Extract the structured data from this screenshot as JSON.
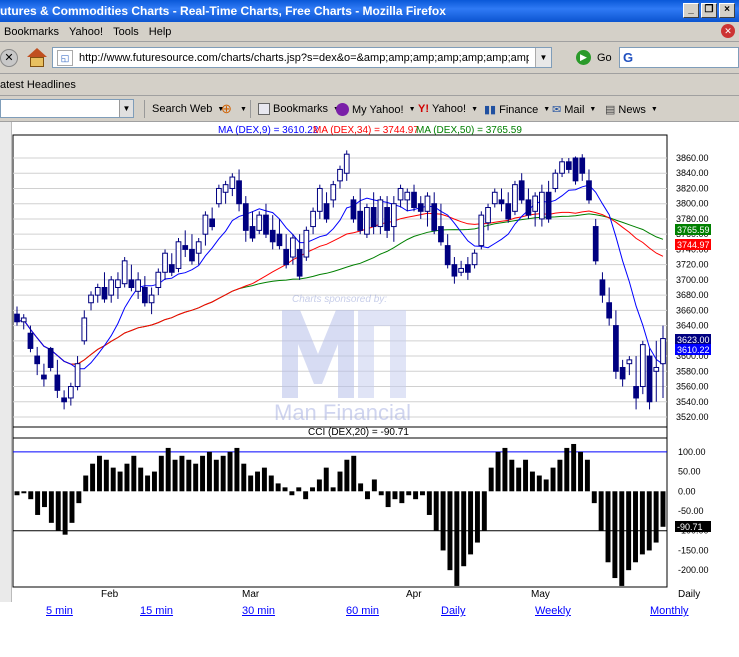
{
  "window": {
    "title": "utures & Commodities Charts - Real-Time Charts, Free Charts - Mozilla Firefox"
  },
  "menu": [
    "Bookmarks",
    "Yahoo!",
    "Tools",
    "Help"
  ],
  "nav": {
    "url": "http://www.futuresource.com/charts/charts.jsp?s=dex&o=&amp;amp;amp;amp;amp;amp;amp;amp;amp;a=",
    "go_label": "Go"
  },
  "bookmarks_bar": {
    "item": "atest Headlines"
  },
  "yahoo_toolbar": {
    "search_web": "Search Web",
    "bookmarks": "Bookmarks",
    "my_yahoo": "My Yahoo!",
    "yahoo": "Yahoo!",
    "finance": "Finance",
    "mail": "Mail",
    "news": "News"
  },
  "chart_data": {
    "type": "candlestick",
    "symbol": "DEX",
    "indicator_header": {
      "ma9": "MA (DEX,9) = 3610.22",
      "ma34": "MA (DEX,34) = 3744.97",
      "ma50": "MA (DEX,50) = 3765.59"
    },
    "y_ticks": [
      "3860.00",
      "3840.00",
      "3820.00",
      "3800.00",
      "3780.00",
      "3760.00",
      "3740.00",
      "3720.00",
      "3700.00",
      "3680.00",
      "3660.00",
      "3640.00",
      "3620.00",
      "3600.00",
      "3580.00",
      "3560.00",
      "3540.00",
      "3520.00"
    ],
    "ylim": [
      3520,
      3860
    ],
    "x_labels": [
      "Feb",
      "Mar",
      "Apr",
      "May",
      "Daily"
    ],
    "value_badges": {
      "ma50": "3765.59",
      "ma34": "3744.97",
      "last": "3623.00",
      "ma9": "3610.22"
    },
    "colors": {
      "ma9": "#0000ff",
      "ma34": "#ff0000",
      "ma50": "#008000",
      "candle": "#000080",
      "cci": "#000000"
    },
    "candles": [
      [
        3655,
        3665,
        3640,
        3645
      ],
      [
        3645,
        3655,
        3635,
        3650
      ],
      [
        3630,
        3640,
        3605,
        3610
      ],
      [
        3600,
        3612,
        3575,
        3590
      ],
      [
        3575,
        3590,
        3560,
        3570
      ],
      [
        3610,
        3612,
        3580,
        3585
      ],
      [
        3575,
        3595,
        3545,
        3555
      ],
      [
        3545,
        3555,
        3530,
        3540
      ],
      [
        3545,
        3565,
        3535,
        3560
      ],
      [
        3560,
        3600,
        3555,
        3590
      ],
      [
        3620,
        3660,
        3615,
        3650
      ],
      [
        3670,
        3685,
        3660,
        3680
      ],
      [
        3680,
        3695,
        3670,
        3690
      ],
      [
        3690,
        3710,
        3670,
        3675
      ],
      [
        3680,
        3705,
        3670,
        3700
      ],
      [
        3690,
        3710,
        3675,
        3700
      ],
      [
        3695,
        3730,
        3690,
        3725
      ],
      [
        3700,
        3720,
        3685,
        3690
      ],
      [
        3685,
        3710,
        3675,
        3700
      ],
      [
        3690,
        3705,
        3665,
        3670
      ],
      [
        3670,
        3690,
        3655,
        3680
      ],
      [
        3690,
        3715,
        3680,
        3710
      ],
      [
        3710,
        3740,
        3700,
        3735
      ],
      [
        3720,
        3735,
        3705,
        3710
      ],
      [
        3715,
        3755,
        3710,
        3750
      ],
      [
        3745,
        3765,
        3730,
        3740
      ],
      [
        3740,
        3760,
        3720,
        3725
      ],
      [
        3735,
        3755,
        3720,
        3750
      ],
      [
        3760,
        3790,
        3745,
        3785
      ],
      [
        3780,
        3795,
        3765,
        3770
      ],
      [
        3800,
        3825,
        3795,
        3820
      ],
      [
        3815,
        3830,
        3800,
        3825
      ],
      [
        3820,
        3840,
        3810,
        3835
      ],
      [
        3830,
        3845,
        3790,
        3800
      ],
      [
        3800,
        3810,
        3750,
        3765
      ],
      [
        3770,
        3790,
        3750,
        3755
      ],
      [
        3765,
        3790,
        3760,
        3785
      ],
      [
        3785,
        3800,
        3755,
        3760
      ],
      [
        3765,
        3785,
        3740,
        3750
      ],
      [
        3760,
        3780,
        3740,
        3745
      ],
      [
        3740,
        3760,
        3715,
        3720
      ],
      [
        3730,
        3760,
        3720,
        3755
      ],
      [
        3740,
        3760,
        3700,
        3705
      ],
      [
        3730,
        3770,
        3725,
        3765
      ],
      [
        3770,
        3795,
        3760,
        3790
      ],
      [
        3790,
        3825,
        3780,
        3820
      ],
      [
        3800,
        3815,
        3775,
        3780
      ],
      [
        3805,
        3830,
        3795,
        3825
      ],
      [
        3830,
        3850,
        3820,
        3845
      ],
      [
        3840,
        3870,
        3830,
        3865
      ],
      [
        3805,
        3810,
        3775,
        3780
      ],
      [
        3790,
        3820,
        3760,
        3765
      ],
      [
        3760,
        3800,
        3755,
        3795
      ],
      [
        3795,
        3815,
        3760,
        3770
      ],
      [
        3770,
        3810,
        3760,
        3805
      ],
      [
        3795,
        3810,
        3755,
        3765
      ],
      [
        3770,
        3810,
        3750,
        3800
      ],
      [
        3805,
        3825,
        3795,
        3820
      ],
      [
        3805,
        3820,
        3790,
        3815
      ],
      [
        3815,
        3825,
        3790,
        3795
      ],
      [
        3800,
        3810,
        3780,
        3790
      ],
      [
        3790,
        3815,
        3770,
        3810
      ],
      [
        3800,
        3815,
        3760,
        3765
      ],
      [
        3770,
        3800,
        3745,
        3750
      ],
      [
        3745,
        3760,
        3715,
        3720
      ],
      [
        3720,
        3730,
        3695,
        3705
      ],
      [
        3710,
        3725,
        3705,
        3715
      ],
      [
        3720,
        3730,
        3700,
        3710
      ],
      [
        3720,
        3740,
        3715,
        3735
      ],
      [
        3745,
        3790,
        3740,
        3785
      ],
      [
        3775,
        3800,
        3765,
        3795
      ],
      [
        3800,
        3820,
        3795,
        3815
      ],
      [
        3805,
        3820,
        3790,
        3800
      ],
      [
        3800,
        3815,
        3775,
        3780
      ],
      [
        3790,
        3830,
        3785,
        3825
      ],
      [
        3830,
        3840,
        3800,
        3805
      ],
      [
        3805,
        3820,
        3780,
        3785
      ],
      [
        3790,
        3815,
        3770,
        3810
      ],
      [
        3780,
        3825,
        3770,
        3815
      ],
      [
        3815,
        3830,
        3775,
        3780
      ],
      [
        3820,
        3845,
        3815,
        3840
      ],
      [
        3840,
        3860,
        3835,
        3855
      ],
      [
        3855,
        3860,
        3840,
        3845
      ],
      [
        3860,
        3862,
        3825,
        3830
      ],
      [
        3860,
        3865,
        3830,
        3840
      ],
      [
        3830,
        3845,
        3800,
        3805
      ],
      [
        3770,
        3780,
        3720,
        3725
      ],
      [
        3700,
        3710,
        3670,
        3680
      ],
      [
        3670,
        3690,
        3640,
        3650
      ],
      [
        3640,
        3660,
        3570,
        3580
      ],
      [
        3585,
        3595,
        3560,
        3570
      ],
      [
        3590,
        3600,
        3575,
        3595
      ],
      [
        3560,
        3600,
        3530,
        3545
      ],
      [
        3560,
        3620,
        3550,
        3615
      ],
      [
        3600,
        3610,
        3530,
        3540
      ],
      [
        3580,
        3620,
        3540,
        3585
      ],
      [
        3590,
        3640,
        3545,
        3623
      ]
    ],
    "cci": {
      "label": "CCI (DEX,20) = -90.71",
      "ticks": [
        "100.00",
        "50.00",
        "0.00",
        "-50.00",
        "-100.00",
        "-150.00",
        "-200.00"
      ],
      "value_badge": "-90.71",
      "ylim": [
        -230,
        125
      ],
      "values": [
        -10,
        -5,
        -20,
        -60,
        -40,
        -80,
        -100,
        -110,
        -80,
        -30,
        40,
        70,
        90,
        80,
        60,
        50,
        70,
        90,
        60,
        40,
        50,
        90,
        110,
        80,
        90,
        80,
        70,
        90,
        100,
        80,
        90,
        100,
        110,
        70,
        40,
        50,
        60,
        40,
        20,
        10,
        -10,
        10,
        -20,
        10,
        30,
        60,
        10,
        50,
        80,
        90,
        20,
        -20,
        30,
        -10,
        -40,
        -20,
        -30,
        -10,
        -20,
        -10,
        -60,
        -100,
        -150,
        -200,
        -240,
        -190,
        -160,
        -130,
        -100,
        60,
        100,
        110,
        80,
        60,
        80,
        50,
        40,
        30,
        60,
        80,
        110,
        120,
        100,
        80,
        -30,
        -100,
        -180,
        -220,
        -240,
        -200,
        -180,
        -160,
        -150,
        -130,
        -90
      ],
      "colors": {
        "upper": "#0000ff",
        "lower": "#000000"
      }
    },
    "watermark": {
      "sponsor_text": "Charts sponsored by:",
      "brand": "Man Financial"
    }
  },
  "bottom_links": [
    "5 min",
    "15 min",
    "30 min",
    "60 min",
    "Daily",
    "Weekly",
    "Monthly"
  ]
}
